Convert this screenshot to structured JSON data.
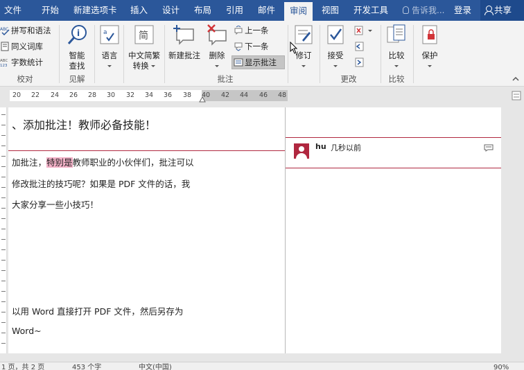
{
  "tabs": {
    "file": "文件",
    "home": "开始",
    "new_tab": "新建选项卡",
    "insert": "插入",
    "design": "设计",
    "layout": "布局",
    "references": "引用",
    "mailings": "邮件",
    "review": "审阅",
    "view": "视图",
    "developer": "开发工具"
  },
  "tell_me": "告诉我...",
  "login": "登录",
  "share": "共享",
  "ribbon": {
    "proofing": {
      "label": "校对",
      "spelling": "拼写和语法",
      "thesaurus": "同义词库",
      "word_count": "字数统计"
    },
    "insights": {
      "label": "见解",
      "smart_lookup": "智能\n查找",
      "smart_lookup_1": "智能",
      "smart_lookup_2": "查找"
    },
    "language": {
      "label": "语言"
    },
    "chinese": {
      "label_1": "中文简繁",
      "label_2": "转换"
    },
    "comments": {
      "label": "批注",
      "new_comment": "新建批注",
      "delete": "删除",
      "previous": "上一条",
      "next": "下一条",
      "show_comments": "显示批注"
    },
    "tracking": {
      "label": "修订"
    },
    "changes": {
      "label": "更改",
      "accept": "接受"
    },
    "compare": {
      "label": "比较",
      "compare_btn": "比较"
    },
    "protect": {
      "label": "保护"
    }
  },
  "ruler": {
    "numbers": [
      "20",
      "22",
      "24",
      "26",
      "28",
      "30",
      "32",
      "34",
      "36",
      "38",
      "40",
      "42",
      "44",
      "46",
      "48"
    ]
  },
  "document": {
    "title": "、添加批注！教师必备技能！",
    "line1_pre": "加批注，",
    "line1_hl": "特别是",
    "line1_post": "教师职业的小伙伴们，批注可以",
    "line2": "修改批注的技巧呢？如果是 PDF 文件的话，我",
    "line3": "大家分享一些小技巧！",
    "line4": "以用 Word 直接打开 PDF 文件，然后另存为",
    "line5": "Word~"
  },
  "comment": {
    "author": "hu",
    "time": "几秒以前"
  },
  "status": {
    "pages": "1 页，共 2 页",
    "words": "453 个字",
    "language": "中文(中国)",
    "zoom": "90%"
  },
  "colors": {
    "brand": "#2b579a",
    "comment_accent": "#b0273f",
    "highlight": "#f4b2c8"
  }
}
